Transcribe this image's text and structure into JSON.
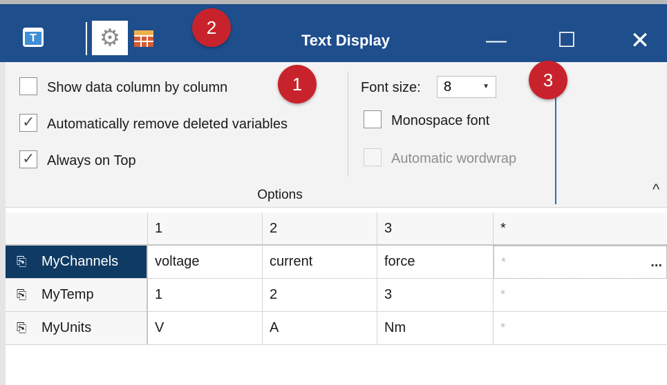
{
  "titlebar": {
    "title": "Text Display",
    "minimize": "—",
    "maximize": "☐",
    "close": "✕",
    "app_icon": "text-display-app-icon",
    "gear_icon": "gear-icon",
    "grid_icon": "table-grid-icon",
    "bg_color": "#1f4e8c"
  },
  "badges": {
    "one": "1",
    "two": "2",
    "three": "3",
    "color": "#c8232c"
  },
  "options": {
    "show_column": {
      "label": "Show data column by column",
      "checked": false
    },
    "auto_remove": {
      "label": "Automatically remove deleted variables",
      "checked": true
    },
    "always_top": {
      "label": "Always on Top",
      "checked": true
    },
    "font_size_label": "Font size:",
    "font_size_value": "8",
    "monospace": {
      "label": "Monospace font",
      "checked": false
    },
    "wordwrap": {
      "label": "Automatic wordwrap",
      "checked": false,
      "disabled": true
    },
    "caption": "Options"
  },
  "table": {
    "columns": [
      "1",
      "2",
      "3",
      "*"
    ],
    "rows": [
      {
        "name": "MyChannels",
        "cells": [
          "voltage",
          "current",
          "force"
        ],
        "star": "*",
        "more": "..."
      },
      {
        "name": "MyTemp",
        "cells": [
          "1",
          "2",
          "3"
        ],
        "star": "*"
      },
      {
        "name": "MyUnits",
        "cells": [
          "V",
          "A",
          "Nm"
        ],
        "star": "*"
      }
    ],
    "active_row_color": "#0f3a63"
  }
}
